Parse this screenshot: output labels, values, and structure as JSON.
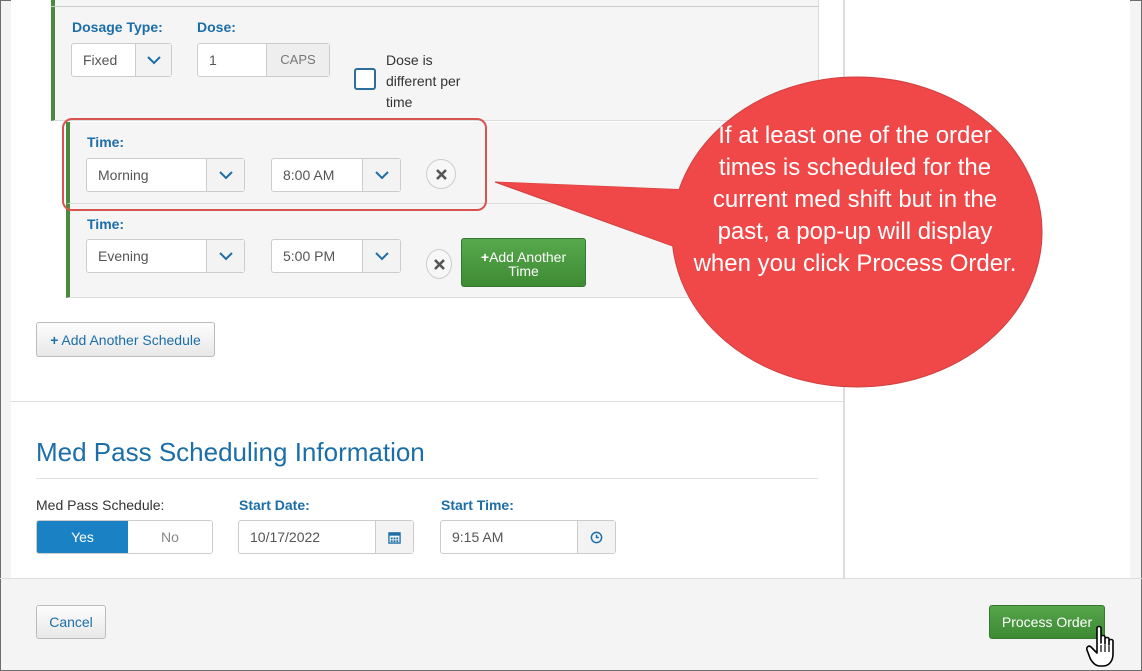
{
  "dosage": {
    "type_label": "Dosage Type:",
    "type_value": "Fixed",
    "dose_label": "Dose:",
    "dose_value": "1",
    "dose_unit": "CAPS",
    "checkbox_label": "Dose is different per time"
  },
  "times": [
    {
      "label": "Time:",
      "period": "Morning",
      "time": "8:00 AM"
    },
    {
      "label": "Time:",
      "period": "Evening",
      "time": "5:00 PM"
    }
  ],
  "add_another_time": {
    "plus": "+",
    "line1": "Add Another",
    "line2": "Time"
  },
  "add_another_schedule": "Add Another Schedule",
  "callout": "If at least one of the order times is scheduled for the current med shift but in the past, a pop-up will display when you click Process Order.",
  "med_pass": {
    "title": "Med Pass Scheduling Information",
    "schedule_label": "Med Pass Schedule:",
    "yes": "Yes",
    "no": "No",
    "start_date_label": "Start Date:",
    "start_date_value": "10/17/2022",
    "start_time_label": "Start Time:",
    "start_time_value": "9:15 AM"
  },
  "footer": {
    "cancel": "Cancel",
    "process": "Process Order"
  },
  "colors": {
    "accent": "#1b6ea8",
    "green": "#4a8a3f",
    "callout": "#f04848",
    "primary_blue": "#1a82c4"
  }
}
